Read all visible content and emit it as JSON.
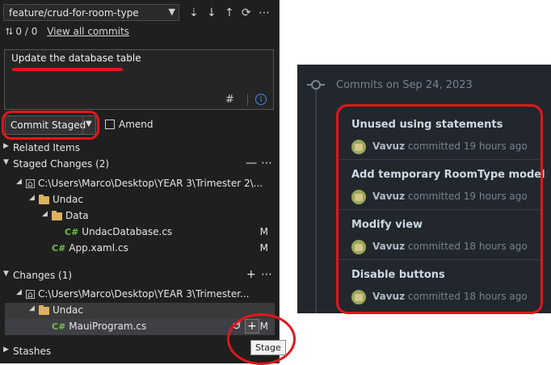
{
  "git": {
    "branch": "feature/crud-for-room-type",
    "sync_counts": "⮁ 0 / 0",
    "view_all_commits": "View all commits",
    "commit_message": "Update the database table",
    "commit_button": "Commit Staged",
    "amend_label": "Amend",
    "related_items": "Related Items",
    "staged_header": "Staged Changes (2)",
    "staged_repo_path": "C:\\Users\\Marco\\Desktop\\YEAR 3\\Trimester 2\\...",
    "staged_folder_undac": "Undac",
    "staged_folder_data": "Data",
    "staged_file_1": "UndacDatabase.cs",
    "staged_file_1_status": "M",
    "staged_file_2": "App.xaml.cs",
    "staged_file_2_status": "M",
    "changes_header": "Changes (1)",
    "changes_repo_path": "C:\\Users\\Marco\\Desktop\\YEAR 3\\Trimester...",
    "changes_folder": "Undac",
    "changes_file": "MauiProgram.cs",
    "changes_file_status": "M",
    "stashes": "Stashes",
    "tooltip": "Stage",
    "csharp_icon_label": "C#"
  },
  "github": {
    "date_header": "Commits on Sep 24, 2023",
    "commits": [
      {
        "title": "Unused using statements",
        "author": "Vavuz",
        "committed": "committed",
        "when": "19 hours ago"
      },
      {
        "title": "Add temporary RoomType model",
        "author": "Vavuz",
        "committed": "committed",
        "when": "19 hours ago"
      },
      {
        "title": "Modify view",
        "author": "Vavuz",
        "committed": "committed",
        "when": "18 hours ago"
      },
      {
        "title": "Disable buttons",
        "author": "Vavuz",
        "committed": "committed",
        "when": "18 hours ago"
      }
    ]
  },
  "colors": {
    "annotation_red": "#e3161a",
    "csharp_green": "#6cc24a",
    "vs_background": "#1f1f1f",
    "github_background": "#22272e"
  }
}
